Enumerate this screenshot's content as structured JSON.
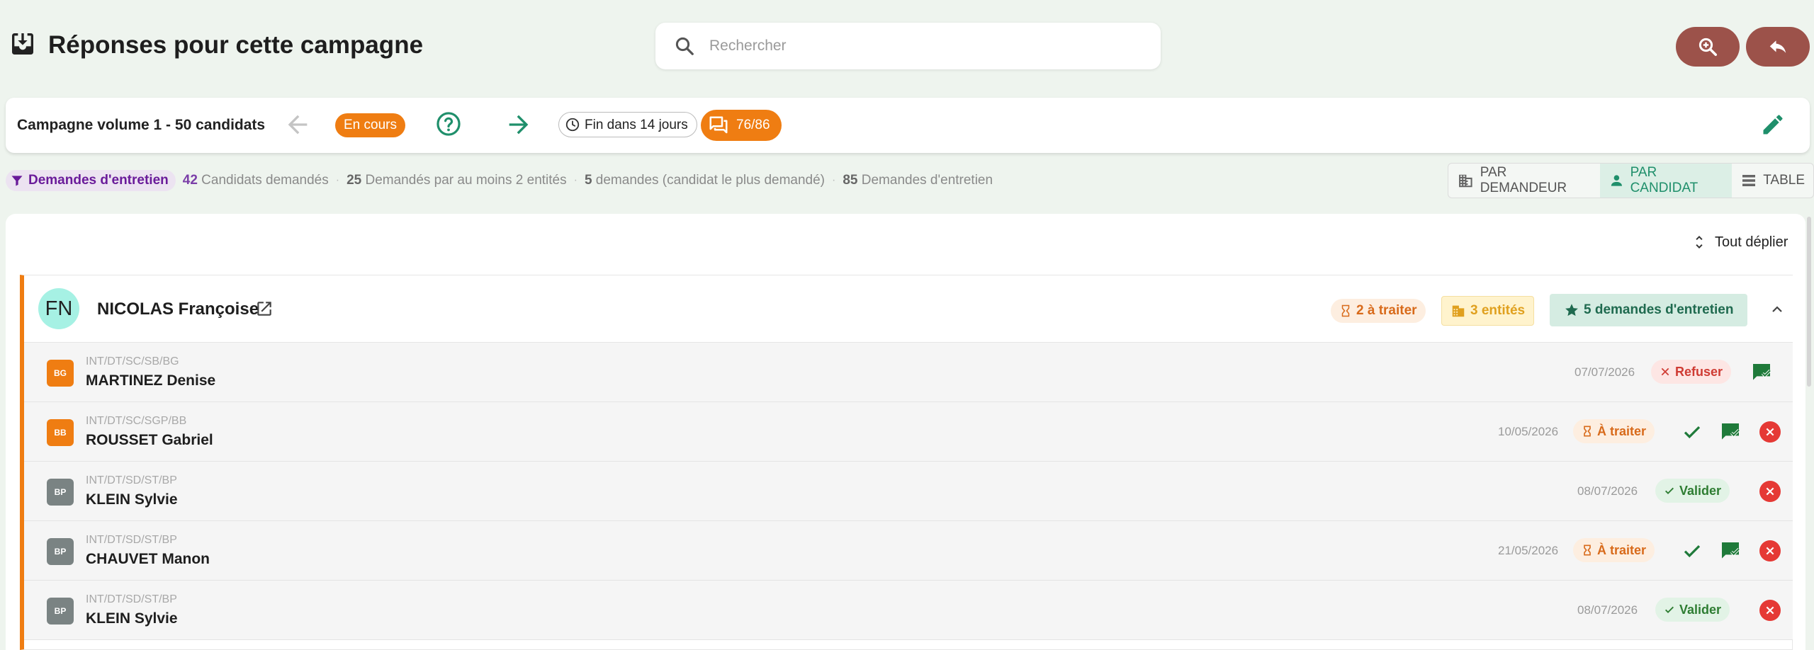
{
  "header": {
    "title": "Réponses pour cette campagne",
    "search_placeholder": "Rechercher"
  },
  "campaign": {
    "title": "Campagne volume 1 - 50 candidats",
    "status": "En cours",
    "deadline": "Fin dans 14 jours",
    "responses": "76/86"
  },
  "stats": {
    "filter_label": "Demandes d'entretien",
    "items": [
      {
        "value": "42",
        "label": "Candidats demandés"
      },
      {
        "value": "25",
        "label": "Demandés par au moins 2 entités"
      },
      {
        "value": "5",
        "label": "demandes (candidat le plus demandé)"
      },
      {
        "value": "85",
        "label": "Demandes d'entretien"
      }
    ]
  },
  "view_toggle": {
    "by_requester": "PAR DEMANDEUR",
    "by_candidate": "PAR CANDIDAT",
    "table": "TABLE",
    "active": "by_candidate"
  },
  "main": {
    "expand_all": "Tout déplier",
    "group": {
      "initials": "FN",
      "name": "NICOLAS Françoise",
      "badge_treat": "2 à traiter",
      "badge_entities": "3 entités",
      "badge_requests": "5 demandes d'entretien",
      "rows": [
        {
          "code": "BG",
          "path": "INT/DT/SC/SB/BG",
          "person": "MARTINEZ Denise",
          "date": "07/07/2026",
          "status": "Refuser"
        },
        {
          "code": "BB",
          "path": "INT/DT/SC/SGP/BB",
          "person": "ROUSSET Gabriel",
          "date": "10/05/2026",
          "status": "À traiter"
        },
        {
          "code": "BP",
          "path": "INT/DT/SD/ST/BP",
          "person": "KLEIN Sylvie",
          "date": "08/07/2026",
          "status": "Valider"
        },
        {
          "code": "BP",
          "path": "INT/DT/SD/ST/BP",
          "person": "CHAUVET Manon",
          "date": "21/05/2026",
          "status": "À traiter"
        },
        {
          "code": "BP",
          "path": "INT/DT/SD/ST/BP",
          "person": "KLEIN Sylvie",
          "date": "08/07/2026",
          "status": "Valider"
        }
      ]
    }
  },
  "colors": {
    "accent_orange": "#ef7d12",
    "teal": "#1f8f6b",
    "danger": "#e53935",
    "brown_button": "#9c524a"
  }
}
